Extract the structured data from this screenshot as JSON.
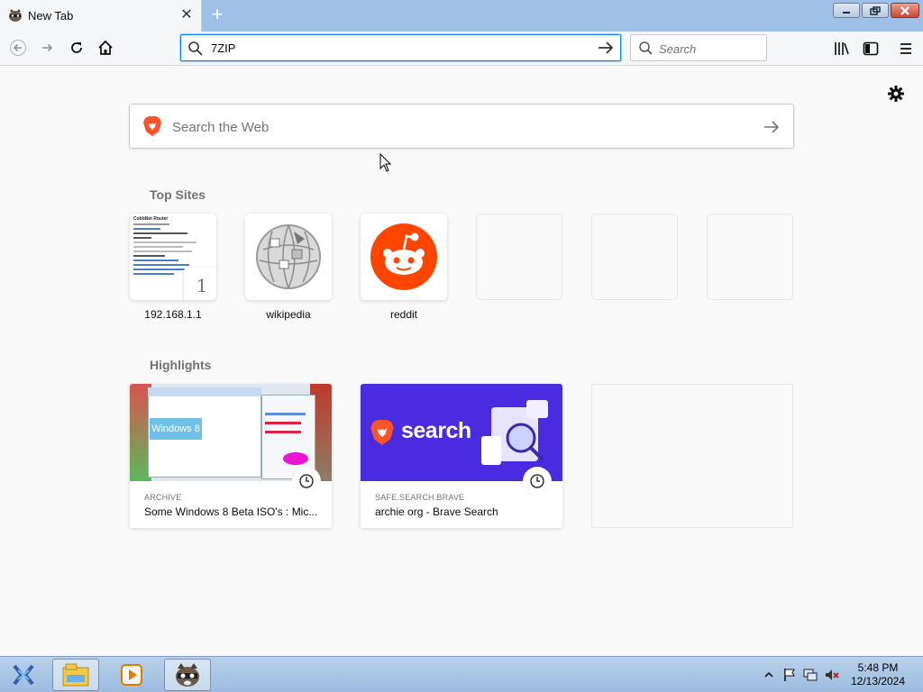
{
  "browser": {
    "tab": {
      "title": "New Tab",
      "favicon": "raccoon-icon",
      "close_icon": "close-icon"
    },
    "new_tab_icon": "plus-icon",
    "window_controls": [
      "minimize-icon",
      "restore-icon",
      "close-icon"
    ],
    "toolbar": {
      "back_icon": "back-arrow-icon",
      "forward_icon": "forward-arrow-icon",
      "reload_icon": "reload-icon",
      "home_icon": "home-icon",
      "url_value": "7ZIP",
      "url_go_icon": "arrow-right-icon",
      "search_placeholder": "Search",
      "library_icon": "library-icon",
      "sidebar_icon": "sidebar-icon",
      "menu_icon": "hamburger-menu-icon"
    }
  },
  "newtab": {
    "settings_icon": "gear-icon",
    "web_search": {
      "placeholder": "Search the Web",
      "logo": "brave-lion-icon"
    },
    "top_sites_title": "Top Sites",
    "top_sites": [
      {
        "label": "192.168.1.1",
        "badge": "1",
        "thumb": "router-page-screenshot"
      },
      {
        "label": "wikipedia",
        "thumb": "wikipedia-globe-icon"
      },
      {
        "label": "reddit",
        "thumb": "reddit-alien-icon"
      },
      {
        "label": ""
      },
      {
        "label": ""
      },
      {
        "label": ""
      }
    ],
    "router_thumb_heading": "CobbNet Router",
    "highlights_title": "Highlights",
    "highlights": [
      {
        "source": "ARCHIVE",
        "title": "Some Windows 8 Beta ISO's : Mic...",
        "image_text": "Windows 8"
      },
      {
        "source": "SAFE.SEARCH.BRAVE",
        "title": "archie org - Brave Search",
        "image_text": "search"
      },
      {
        "source": "",
        "title": ""
      }
    ]
  },
  "taskbar": {
    "apps": [
      "windows-explorer-icon",
      "media-player-icon",
      "raccoon-browser-icon"
    ],
    "time": "5:48 PM",
    "date": "12/13/2024"
  },
  "colors": {
    "accent": "#0a84ff",
    "brave_orange": "#fb542b",
    "reddit_orange": "#ff4500",
    "brave_search_bg": "#4a2be0",
    "taskbar": "#a9c6e6"
  }
}
